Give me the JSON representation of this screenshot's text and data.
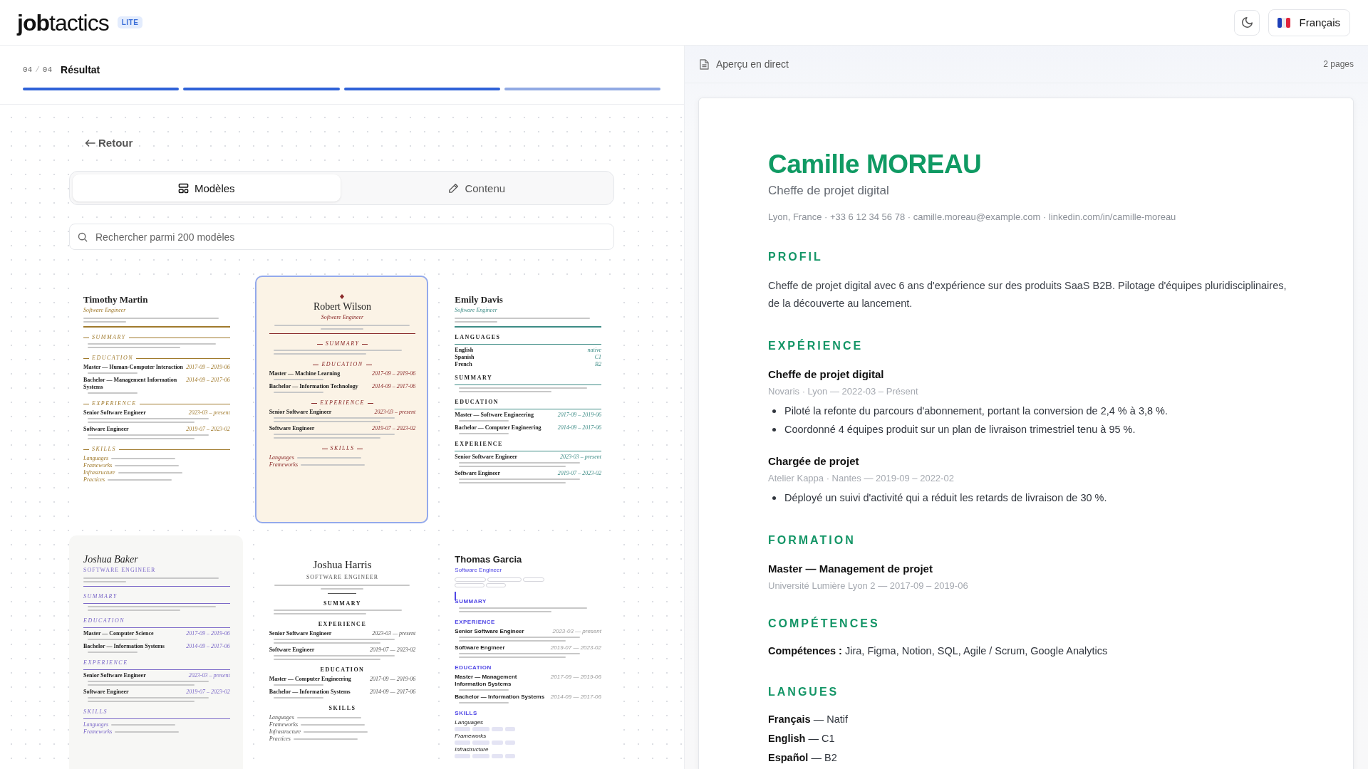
{
  "header": {
    "logo": "**job**tactics",
    "badge": "LITE",
    "language": "Français"
  },
  "steps": {
    "current": "04",
    "separator": "/",
    "total": "04",
    "title": "Résultat",
    "segments": [
      {
        "done": true
      },
      {
        "done": true
      },
      {
        "done": true
      },
      {
        "done": false
      }
    ]
  },
  "back_link": "Retour",
  "tabs": [
    {
      "kind": "templates",
      "label": "Modèles",
      "selected": true
    },
    {
      "kind": "content",
      "label": "Contenu",
      "selected": false
    }
  ],
  "search": {
    "placeholder": "Rechercher parmi 200 modèles"
  },
  "templates": [
    {
      "kind": "classic",
      "name": "Timothy Martin",
      "role": "Software Engineer",
      "color": "#a07a2c",
      "selected": false,
      "sections": [
        {
          "kind": "summary",
          "heading": "SUMMARY"
        },
        {
          "kind": "education",
          "heading": "EDUCATION",
          "entries": [
            {
              "title": "Master — Human-Computer Interaction",
              "date": "2017-09 – 2019-06"
            },
            {
              "title": "Bachelor — Management Information Systems",
              "date": "2014-09 – 2017-06"
            }
          ]
        },
        {
          "kind": "experience",
          "heading": "EXPERIENCE",
          "entries": [
            {
              "title": "Senior Software Engineer",
              "date": "2023-03 – present"
            },
            {
              "title": "Software Engineer",
              "date": "2019-07 – 2023-02"
            }
          ]
        },
        {
          "kind": "skills",
          "heading": "SKILLS",
          "entries": [
            {
              "title": "Languages"
            },
            {
              "title": "Frameworks"
            },
            {
              "title": "Infrastructure"
            },
            {
              "title": "Practices"
            }
          ]
        }
      ]
    },
    {
      "kind": "cream",
      "name": "Robert Wilson",
      "role": "Software Engineer",
      "color": "#8b2b2b",
      "selected": true,
      "sections": [
        {
          "kind": "summary",
          "heading": "SUMMARY"
        },
        {
          "kind": "education",
          "heading": "EDUCATION",
          "entries": [
            {
              "title": "Master — Machine Learning",
              "date": "2017-09 – 2019-06"
            },
            {
              "title": "Bachelor — Information Technology",
              "date": "2014-09 – 2017-06"
            }
          ]
        },
        {
          "kind": "experience",
          "heading": "EXPERIENCE",
          "entries": [
            {
              "title": "Senior Software Engineer",
              "date": "2023-03 – present"
            },
            {
              "title": "Software Engineer",
              "date": "2019-07 – 2023-02"
            }
          ]
        },
        {
          "kind": "skills",
          "heading": "SKILLS",
          "entries": [
            {
              "title": "Languages"
            },
            {
              "title": "Frameworks"
            }
          ]
        }
      ]
    },
    {
      "kind": "ruled",
      "name": "Emily Davis",
      "role": "Software Engineer",
      "color": "#3d8c86",
      "selected": false,
      "sections": [
        {
          "kind": "languages",
          "heading": "LANGUAGES",
          "entries": [
            {
              "title": "English",
              "date": "native"
            },
            {
              "title": "Spanish",
              "date": "C1"
            },
            {
              "title": "French",
              "date": "B2"
            }
          ]
        },
        {
          "kind": "summary",
          "heading": "SUMMARY"
        },
        {
          "kind": "education",
          "heading": "EDUCATION",
          "entries": [
            {
              "title": "Master — Software Engineering",
              "date": "2017-09 – 2019-06"
            },
            {
              "title": "Bachelor — Computer Engineering",
              "date": "2014-09 – 2017-06"
            }
          ]
        },
        {
          "kind": "experience",
          "heading": "EXPERIENCE",
          "entries": [
            {
              "title": "Senior Software Engineer",
              "date": "2023-03 – present"
            },
            {
              "title": "Software Engineer",
              "date": "2019-07 – 2023-02"
            }
          ]
        }
      ]
    },
    {
      "kind": "elegant",
      "name": "Joshua Baker",
      "role": "SOFTWARE ENGINEER",
      "color": "#7b68c8",
      "selected": false,
      "sections": [
        {
          "kind": "summary",
          "heading": "SUMMARY"
        },
        {
          "kind": "education",
          "heading": "EDUCATION",
          "entries": [
            {
              "title": "Master — Computer Science",
              "date": "2017-09 – 2019-06"
            },
            {
              "title": "Bachelor — Information Systems",
              "date": "2014-09 – 2017-06"
            }
          ]
        },
        {
          "kind": "experience",
          "heading": "EXPERIENCE",
          "entries": [
            {
              "title": "Senior Software Engineer",
              "date": "2023-03 – present"
            },
            {
              "title": "Software Engineer",
              "date": "2019-07 – 2023-02"
            }
          ]
        },
        {
          "kind": "skills",
          "heading": "SKILLS",
          "entries": [
            {
              "title": "Languages"
            },
            {
              "title": "Frameworks"
            }
          ]
        }
      ]
    },
    {
      "kind": "minimal",
      "name": "Joshua Harris",
      "role": "SOFTWARE ENGINEER",
      "color": "#555555",
      "selected": false,
      "sections": [
        {
          "kind": "summary",
          "heading": "SUMMARY"
        },
        {
          "kind": "experience",
          "heading": "EXPERIENCE",
          "entries": [
            {
              "title": "Senior Software Engineer",
              "date": "2023-03 — present"
            },
            {
              "title": "Software Engineer",
              "date": "2019-07 — 2023-02"
            }
          ]
        },
        {
          "kind": "education",
          "heading": "EDUCATION",
          "entries": [
            {
              "title": "Master — Computer Engineering",
              "date": "2017-09 — 2019-06"
            },
            {
              "title": "Bachelor — Information Systems",
              "date": "2014-09 — 2017-06"
            }
          ]
        },
        {
          "kind": "skills",
          "heading": "SKILLS",
          "entries": [
            {
              "title": "Languages"
            },
            {
              "title": "Frameworks"
            },
            {
              "title": "Infrastructure"
            },
            {
              "title": "Practices"
            }
          ]
        }
      ]
    },
    {
      "kind": "modern",
      "name": "Thomas Garcia",
      "role": "Software Engineer",
      "color": "#4f46e5",
      "selected": false,
      "sections": [
        {
          "kind": "summary",
          "heading": "SUMMARY"
        },
        {
          "kind": "experience",
          "heading": "EXPERIENCE",
          "entries": [
            {
              "title": "Senior Software Engineer",
              "date": "2023-03 — present"
            },
            {
              "title": "Software Engineer",
              "date": "2019-07 — 2023-02"
            }
          ]
        },
        {
          "kind": "education",
          "heading": "EDUCATION",
          "entries": [
            {
              "title": "Master — Management Information Systems",
              "date": "2017-09 — 2019-06"
            },
            {
              "title": "Bachelor — Information Systems",
              "date": "2014-09 — 2017-06"
            }
          ]
        },
        {
          "kind": "chips",
          "heading": "SKILLS",
          "entries": [
            {
              "title": "Languages"
            },
            {
              "title": "Frameworks"
            },
            {
              "title": "Infrastructure"
            }
          ]
        }
      ]
    }
  ],
  "preview": {
    "title": "Aperçu en direct",
    "pages": "2 pages",
    "name": "Camille MOREAU",
    "headline": "Cheffe de projet digital",
    "contact": "Lyon, France · +33 6 12 34 56 78 · camille.moreau@example.com · linkedin.com/in/camille-moreau",
    "sections": [
      {
        "kind": "paragraph",
        "heading": "PROFIL",
        "text": "Cheffe de projet digital avec 6 ans d'expérience sur des produits SaaS B2B. Pilotage d'équipes pluridisciplinaires, de la découverte au lancement."
      },
      {
        "kind": "entries",
        "heading": "EXPÉRIENCE",
        "entries": [
          {
            "title": "Cheffe de projet digital",
            "meta": "Novaris · Lyon — 2022-03 – Présent",
            "bullets": [
              "Piloté la refonte du parcours d'abonnement, portant la conversion de 2,4 % à 3,8 %.",
              "Coordonné 4 équipes produit sur un plan de livraison trimestriel tenu à 95 %."
            ]
          },
          {
            "title": "Chargée de projet",
            "meta": "Atelier Kappa · Nantes — 2019-09 – 2022-02",
            "bullets": [
              "Déployé un suivi d'activité qui a réduit les retards de livraison de 30 %."
            ]
          }
        ]
      },
      {
        "kind": "entries",
        "heading": "FORMATION",
        "entries": [
          {
            "title": "Master — Management de projet",
            "meta": "Université Lumière Lyon 2 — 2017-09 – 2019-06"
          }
        ]
      },
      {
        "kind": "lines",
        "heading": "COMPÉTENCES",
        "lines": [
          "**Compétences :** Jira, Figma, Notion, SQL, Agile / Scrum, Google Analytics"
        ]
      },
      {
        "kind": "lines",
        "heading": "LANGUES",
        "lines": [
          "**Français** — Natif",
          "**English** — C1",
          "**Español** — B2"
        ]
      }
    ]
  }
}
